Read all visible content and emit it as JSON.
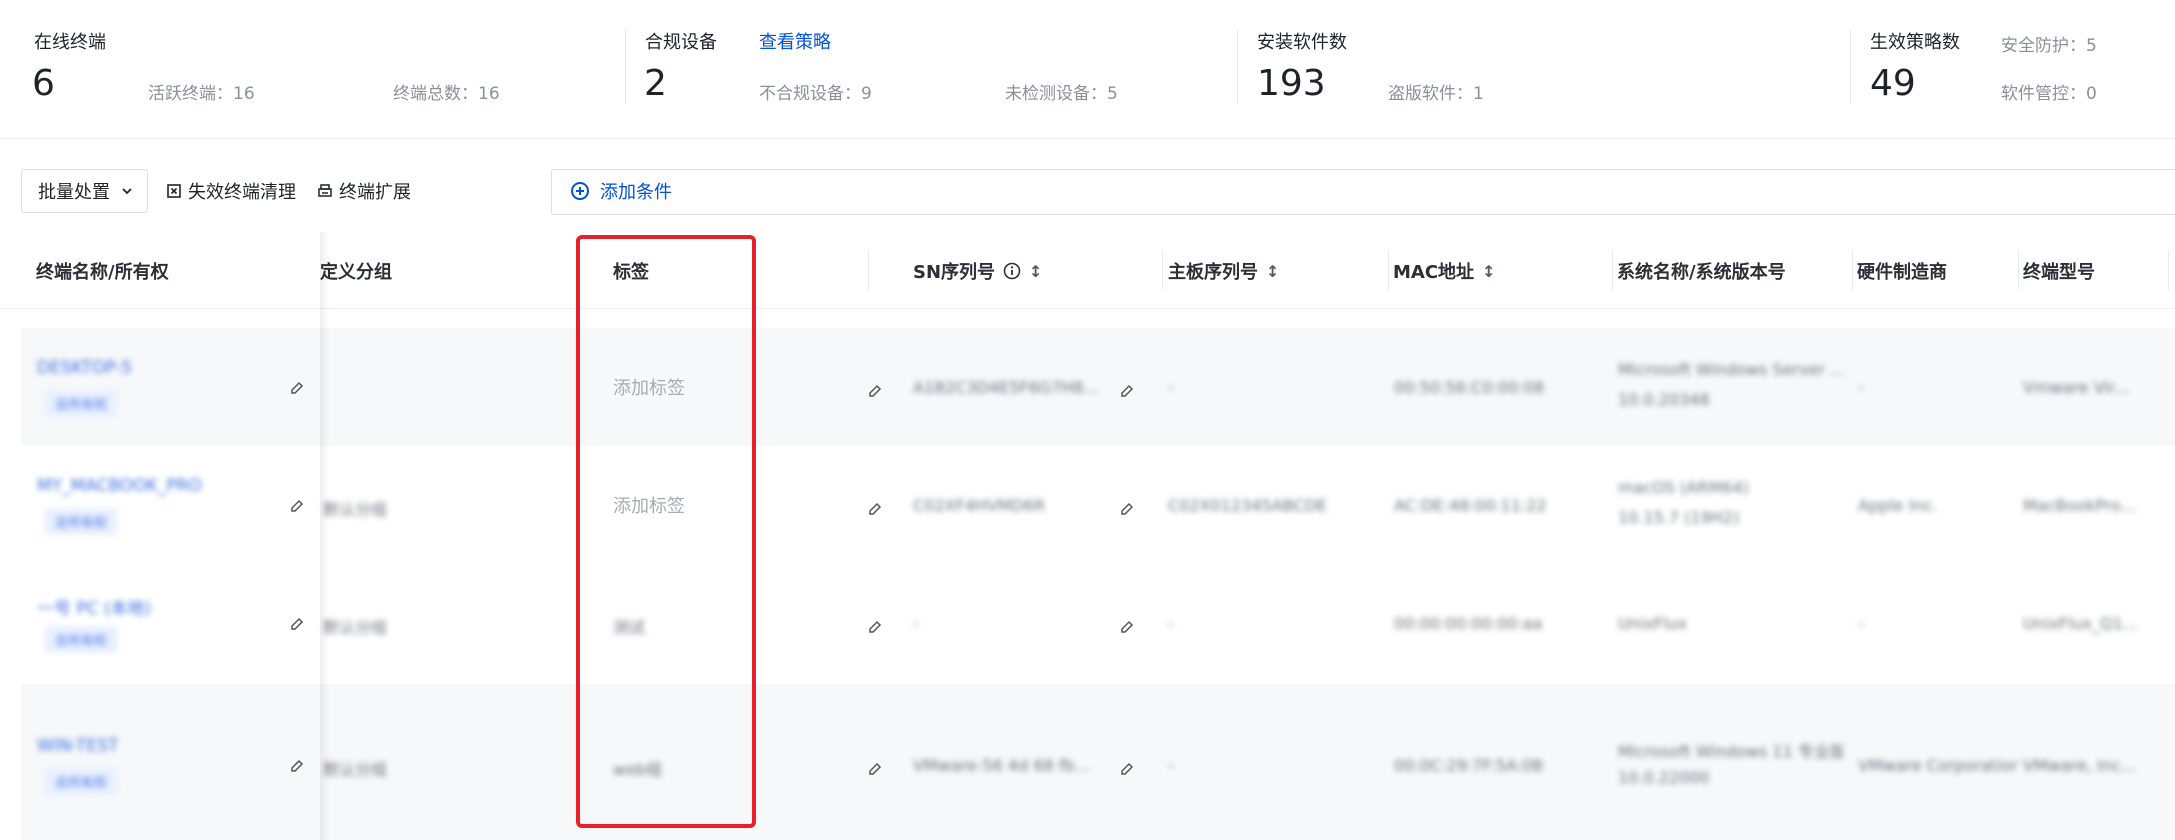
{
  "stats": {
    "online": {
      "title": "在线终端",
      "value": "6",
      "active": "活跃终端：16",
      "total": "终端总数：16"
    },
    "compliance": {
      "title": "合规设备",
      "link": "查看策略",
      "value": "2",
      "noncompliant": "不合规设备：9",
      "unchecked": "未检测设备：5"
    },
    "software": {
      "title": "安装软件数",
      "value": "193",
      "pirated": "盗版软件：1"
    },
    "policy": {
      "title": "生效策略数",
      "value": "49",
      "security": "安全防护：5",
      "control": "软件管控：0"
    }
  },
  "toolbar": {
    "batch_label": "批量处置",
    "cleanup_label": "失效终端清理",
    "extend_label": "终端扩展",
    "add_condition_label": "添加条件"
  },
  "table": {
    "headers": {
      "name": "终端名称/所有权",
      "group": "定义分组",
      "tag": "标签",
      "sn": "SN序列号",
      "board": "主板序列号",
      "mac": "MAC地址",
      "os": "系统名称/系统版本号",
      "vendor": "硬件制造商",
      "model": "终端型号"
    },
    "rows": [
      {
        "name": "DESKTOP-5",
        "badge": "总所有权",
        "group": "",
        "tag": "添加标签",
        "sn": "A1B2C3D4E5F6G7H8...",
        "board": "-",
        "mac": "00:50:56:C0:00:08",
        "os1": "Microsoft Windows Server ...",
        "os2": "10.0.20348",
        "vendor": "-",
        "model": "Vmware Vir..."
      },
      {
        "name": "MY_MACBOOK_PRO",
        "badge": "总所有权",
        "group": "默认分组",
        "tag": "添加标签",
        "sn": "C02XF4HVMD6R",
        "board": "C02X012345ABCDE",
        "mac": "AC:DE:48:00:11:22",
        "os1": "macOS (ARM64)",
        "os2": "10.15.7 (19H2)",
        "vendor": "Apple Inc.",
        "model": "MacBookPro..."
      },
      {
        "name": "一号 PC (本地)",
        "badge": "总所有权",
        "group": "默认分组",
        "tag": "测试",
        "sn": "-",
        "board": "-",
        "mac": "00:00:00:00:00:aa",
        "os1": "UnixFlux",
        "os2": "",
        "vendor": "-",
        "model": "UnixFlux_Q1..."
      },
      {
        "name": "WIN-TEST",
        "badge": "总所有权",
        "group": "默认分组",
        "tag": "web组",
        "sn": "VMware-56 4d 68 fb...",
        "board": "-",
        "mac": "00:0C:29:7F:5A:0B",
        "os1": "Microsoft Windows 11 专业版",
        "os2": "10.0.22000",
        "vendor": "VMware Corporation",
        "model": "VMware, Inc..."
      }
    ]
  },
  "colors": {
    "accent": "#0052d9",
    "highlight": "#e8202a",
    "row_alt": "#f7f8fa"
  }
}
